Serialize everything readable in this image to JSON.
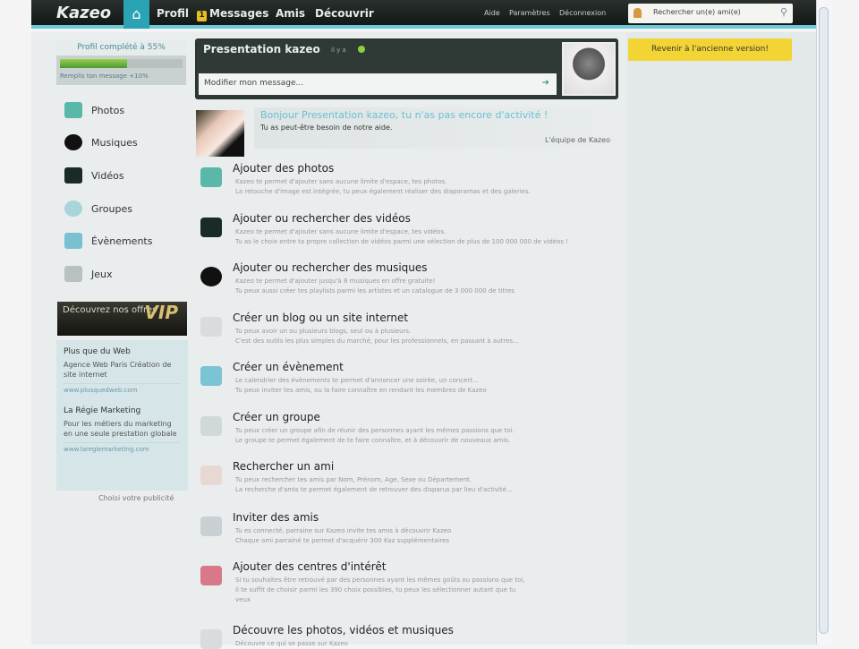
{
  "topbar": {
    "logo": "Kazeo",
    "nav": [
      "Profil",
      "Messages",
      "Amis",
      "Découvrir"
    ],
    "message_count": "1",
    "links": [
      "Aide",
      "Paramètres",
      "Déconnexion"
    ],
    "search_placeholder": "Rechercher un(e) ami(e)"
  },
  "profile": {
    "completion": "Profil complété à 55%",
    "progress": 0.55,
    "bonus": "Remplis ton message +10%"
  },
  "sidebar": {
    "items": [
      "Photos",
      "Musiques",
      "Vidéos",
      "Groupes",
      "Évènements",
      "Jeux"
    ]
  },
  "offer": {
    "label": "Découvrez nos offres",
    "badge": "VIP"
  },
  "ads": [
    {
      "title": "Plus que du Web",
      "text": "Agence Web Paris Création de site internet",
      "url": "www.plusquedweb.com"
    },
    {
      "title": "La Régie Marketing",
      "text": "Pour les métiers du marketing en une seule prestation globale",
      "url": "www.laregiemarketing.com"
    }
  ],
  "ads_footer": "Choisi votre publicité",
  "status": {
    "name": "Presentation kazeo",
    "meta": "il y a",
    "message_placeholder": "Modifier mon message..."
  },
  "welcome": {
    "title": "Bonjour Presentation kazeo, tu n'as pas encore d'activité !",
    "subtitle": "Tu as peut-être besoin de notre aide.",
    "sign": "L'équipe de Kazeo"
  },
  "old_version": "Revenir à l'ancienne version!",
  "actions": [
    {
      "title": "Ajouter des photos",
      "desc": [
        "Kazeo te permet d'ajouter sans aucune limite d'espace, tes photos.",
        "La retouche d'image est intégrée, tu peux également réaliser des diaporamas et des galeries."
      ]
    },
    {
      "title": "Ajouter ou rechercher des vidéos",
      "desc": [
        "Kazeo te permet d'ajouter sans aucune limite d'espace, tes vidéos.",
        "Tu as le choix entre ta propre collection de vidéos parmi une sélection de plus de 100 000 000 de vidéos !"
      ]
    },
    {
      "title": "Ajouter ou rechercher des musiques",
      "desc": [
        "Kazeo te permet d'ajouter jusqu'à 8 musiques en offre gratuite!",
        "Tu peux aussi créer tes playlists parmi les artistes et un catalogue de 3 000 000 de titres"
      ]
    },
    {
      "title": "Créer un blog ou un site internet",
      "desc": [
        "Tu peux avoir un ou plusieurs blogs, seul ou à plusieurs.",
        "C'est des outils les plus simples du marché, pour les professionnels, en passant à autres..."
      ]
    },
    {
      "title": "Créer un évènement",
      "desc": [
        "Le calendrier des évènements te permet d'annoncer une soirée, un concert...",
        "Tu peux inviter tes amis, ou la faire connaître en rendant les membres de Kazeo"
      ]
    },
    {
      "title": "Créer un groupe",
      "desc": [
        "Tu peux créer un groupe afin de réunir des personnes ayant les mêmes passions que toi.",
        "Le groupe te permet également de te faire connaître, et à découvrir de nouveaux amis."
      ]
    },
    {
      "title": "Rechercher un ami",
      "desc": [
        "Tu peux rechercher tes amis par Nom, Prénom, Age, Sexe ou Département.",
        "La recherche d'amis te permet également de retrouver des disparus par lieu d'activité..."
      ]
    },
    {
      "title": "Inviter des amis",
      "desc": [
        "Tu es connecté, parraine sur Kazeo invite tes amis à découvrir Kazeo",
        "Chaque ami parrainé te permet d'acquérir 300 Kaz supplémentaires"
      ]
    },
    {
      "title": "Ajouter des centres d'intérêt",
      "desc": [
        "Si tu souhaites être retrouvé par des personnes ayant les mêmes goûts ou passions que toi,",
        "il te suffit de choisir parmi les 390 choix possibles, tu peux les sélectionner autant que tu",
        "veux"
      ]
    },
    {
      "title": "Découvre les photos, vidéos et musiques",
      "desc": [
        "Découvre ce qui se passe sur Kazeo"
      ]
    }
  ]
}
